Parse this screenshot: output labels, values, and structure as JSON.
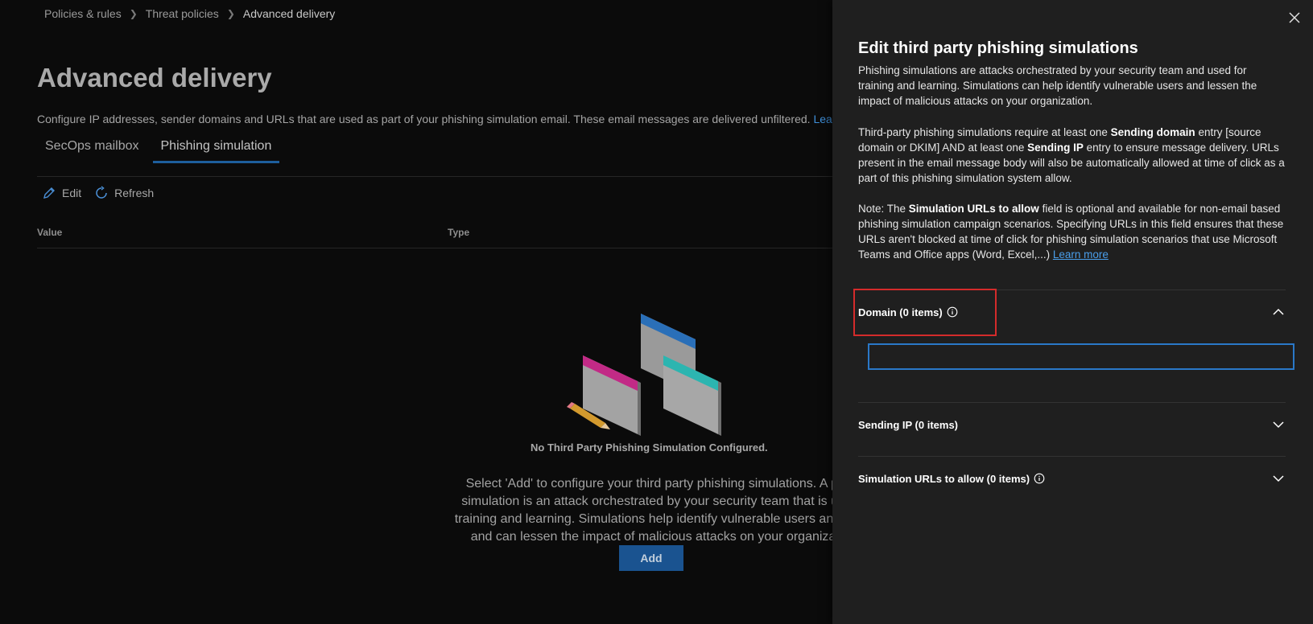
{
  "breadcrumb": {
    "items": [
      "Policies & rules",
      "Threat policies",
      "Advanced delivery"
    ]
  },
  "page": {
    "title": "Advanced delivery",
    "description": "Configure IP addresses, sender domains and URLs that are used as part of your phishing simulation email. These email messages are delivered unfiltered.",
    "learn_more": "Learn mo",
    "tabs": [
      {
        "label": "SecOps mailbox",
        "active": false
      },
      {
        "label": "Phishing simulation",
        "active": true
      }
    ],
    "toolbar": {
      "edit_label": "Edit",
      "refresh_label": "Refresh"
    },
    "columns": [
      "Value",
      "Type"
    ],
    "empty_state": {
      "title": "No Third Party Phishing Simulation Configured.",
      "lines": [
        "Select 'Add' to configure your third party phishing simulations. A phis",
        "simulation is an attack orchestrated by your security team that is used",
        "training and learning. Simulations help identify vulnerable users and beh",
        "and can lessen the impact of malicious attacks on your organizatio"
      ],
      "add_label": "Add"
    }
  },
  "panel": {
    "title": "Edit third party phishing simulations",
    "intro": "Phishing simulations are attacks orchestrated by your security team and used for training and learning. Simulations can help identify vulnerable users and lessen the impact of malicious attacks on your organization.",
    "req": {
      "t1": "Third-party phishing simulations require at least one ",
      "b1": "Sending domain",
      "t2": " entry [source domain or DKIM] AND at least one ",
      "b2": "Sending IP",
      "t3": " entry to ensure message delivery. URLs present in the email message body will also be automatically allowed at time of click as a part of this phishing simulation system allow."
    },
    "note": {
      "t1": "Note: The ",
      "b1": "Simulation URLs to allow",
      "t2": " field is optional and available for non-email based phishing simulation campaign scenarios. Specifying URLs in this field ensures that these URLs aren't blocked at time of click for phishing simulation scenarios that use Microsoft Teams and Office apps (Word, Excel,...) ",
      "link": "Learn more"
    },
    "sections": {
      "domain": {
        "label": "Domain (0 items)",
        "expanded": true,
        "input_value": ""
      },
      "sending_ip": {
        "label": "Sending IP (0 items)",
        "expanded": false
      },
      "urls": {
        "label": "Simulation URLs to allow (0 items)",
        "expanded": false
      }
    }
  },
  "colors": {
    "accent": "#2a78c8",
    "highlight": "#d42b2b",
    "panel_bg": "#1f1f1f",
    "page_bg": "#0b0b0b"
  }
}
